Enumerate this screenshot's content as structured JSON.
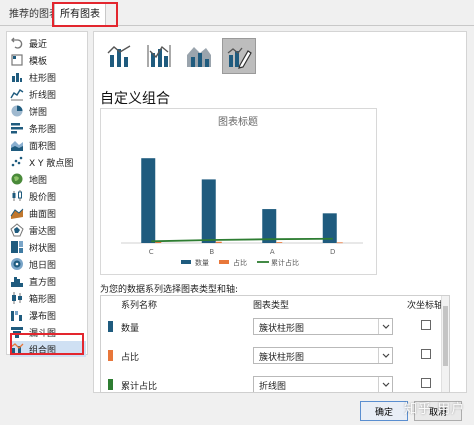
{
  "tabs": [
    {
      "label": "推荐的图表"
    },
    {
      "label": "所有图表"
    }
  ],
  "sidebar": {
    "items": [
      {
        "label": "最近",
        "icon": "undo-icon"
      },
      {
        "label": "模板",
        "icon": "template-icon"
      },
      {
        "label": "柱形图",
        "icon": "column-chart-icon"
      },
      {
        "label": "折线图",
        "icon": "line-chart-icon"
      },
      {
        "label": "饼图",
        "icon": "pie-chart-icon"
      },
      {
        "label": "条形图",
        "icon": "bar-chart-icon"
      },
      {
        "label": "面积图",
        "icon": "area-chart-icon"
      },
      {
        "label": "X Y 散点图",
        "icon": "scatter-chart-icon"
      },
      {
        "label": "地图",
        "icon": "map-chart-icon"
      },
      {
        "label": "股价图",
        "icon": "stock-chart-icon"
      },
      {
        "label": "曲面图",
        "icon": "surface-chart-icon"
      },
      {
        "label": "雷达图",
        "icon": "radar-chart-icon"
      },
      {
        "label": "树状图",
        "icon": "treemap-chart-icon"
      },
      {
        "label": "旭日图",
        "icon": "sunburst-chart-icon"
      },
      {
        "label": "直方图",
        "icon": "histogram-chart-icon"
      },
      {
        "label": "箱形图",
        "icon": "box-whisker-chart-icon"
      },
      {
        "label": "瀑布图",
        "icon": "waterfall-chart-icon"
      },
      {
        "label": "漏斗图",
        "icon": "funnel-chart-icon"
      },
      {
        "label": "组合图",
        "icon": "combo-chart-icon"
      }
    ],
    "active_index": 18
  },
  "chart_types": [
    {
      "icon": "clustered-column-line-icon"
    },
    {
      "icon": "clustered-column-line-secondary-axis-icon"
    },
    {
      "icon": "stacked-area-clustered-column-icon"
    },
    {
      "icon": "custom-combination-icon"
    }
  ],
  "selected_chart_type_index": 3,
  "section_title": "自定义组合",
  "preview_chart": {
    "title": "图表标题",
    "categories": [
      "C",
      "B",
      "A",
      "D"
    ],
    "series": [
      {
        "name": "数量",
        "type": "bar",
        "color": "#1f5b7e",
        "values": [
          20,
          15,
          8,
          7
        ]
      },
      {
        "name": "占比",
        "type": "bar",
        "color": "#e8773a",
        "values": [
          0.4,
          0.3,
          0.2,
          0.15
        ]
      },
      {
        "name": "累计占比",
        "type": "line",
        "color": "#2e7d32",
        "values": [
          0.4,
          0.7,
          0.9,
          1.0
        ]
      }
    ],
    "ylim": [
      0,
      25
    ],
    "y_ticks": [
      "0",
      "5",
      "10",
      "15",
      "20",
      "25"
    ]
  },
  "series_prompt": "为您的数据系列选择图表类型和轴:",
  "series_table": {
    "headers": {
      "name": "系列名称",
      "type": "图表类型",
      "secondary": "次坐标轴"
    },
    "rows": [
      {
        "name": "数量",
        "color": "#1f5b7e",
        "type": "簇状柱形图",
        "secondary": false
      },
      {
        "name": "占比",
        "color": "#e8773a",
        "type": "簇状柱形图",
        "secondary": false
      },
      {
        "name": "累计占比",
        "color": "#2e7d32",
        "type": "折线图",
        "secondary": false
      }
    ]
  },
  "buttons": {
    "ok": "确定",
    "cancel": "取消"
  },
  "watermark": "知乎 用户",
  "colors": {
    "highlight_red": "#e3262e",
    "accent_blue": "#1f5b7e",
    "selection": "#cfe0f3"
  }
}
